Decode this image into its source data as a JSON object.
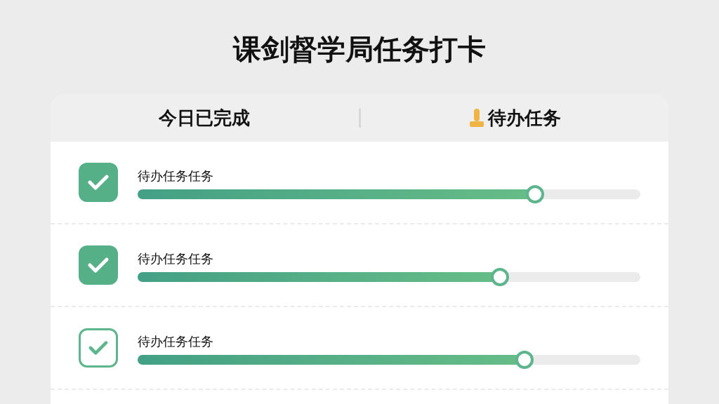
{
  "title": "课剑督学局任务打卡",
  "header": {
    "left": "今日已完成",
    "right": "待办任务"
  },
  "tasks": [
    {
      "name": "待办任务任务",
      "kind": "filled",
      "checked": true,
      "level": 0.79
    },
    {
      "name": "待办任务任务",
      "kind": "filled",
      "checked": true,
      "level": 0.72
    },
    {
      "name": "待办任务任务",
      "kind": "outline",
      "checked": true,
      "level": 0.77
    }
  ]
}
